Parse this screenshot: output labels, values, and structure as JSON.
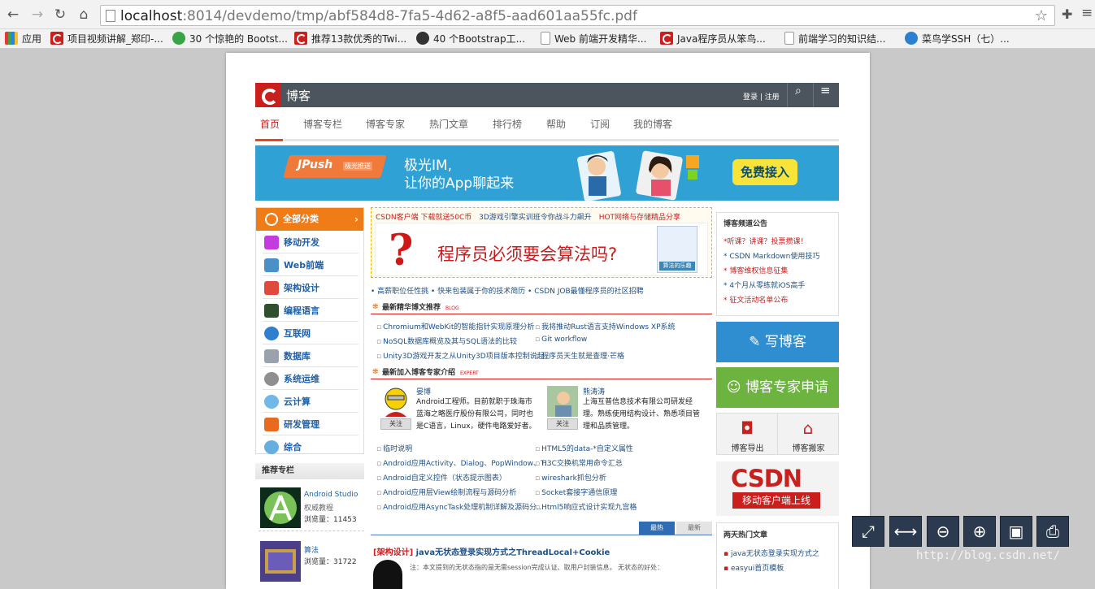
{
  "browser": {
    "back_icon": "arrow-left-icon",
    "url_host": "localhost",
    "url_path": ":8014/devdemo/tmp/abf584d8-7fa5-4d62-a8f5-aad601aa55fc.pdf"
  },
  "bookmarks": [
    {
      "label": "应用"
    },
    {
      "label": "项目视频讲解_郑印-..."
    },
    {
      "label": "30 个惊艳的 Bootst..."
    },
    {
      "label": "推荐13款优秀的Twi..."
    },
    {
      "label": "40 个Bootstrap工..."
    },
    {
      "label": "Web 前端开发精华..."
    },
    {
      "label": "Java程序员从笨鸟..."
    },
    {
      "label": "前端学习的知识结..."
    },
    {
      "label": "菜鸟学SSH（七）..."
    }
  ],
  "site": {
    "title": "博客",
    "login": "登录",
    "register": "注册",
    "tabs": [
      "首页",
      "博客专栏",
      "博客专家",
      "热门文章",
      "排行榜",
      "帮助",
      "订阅",
      "我的博客"
    ]
  },
  "banner": {
    "jpush": "JPush",
    "jpush_sub": "极光推送",
    "line1": "极光IM,",
    "line2": "让你的App聊起来",
    "cta": "免费接入"
  },
  "categories": {
    "header": "全部分类",
    "items": [
      "移动开发",
      "Web前端",
      "架构设计",
      "编程语言",
      "互联网",
      "数据库",
      "系统运维",
      "云计算",
      "研发管理",
      "综合"
    ]
  },
  "recommend": {
    "title": "推荐专栏",
    "items": [
      {
        "name": "Android Studio",
        "sub": "权威教程",
        "views": "浏览量：11453"
      },
      {
        "name": "算法",
        "sub": "",
        "views": "浏览量：31722"
      }
    ]
  },
  "promo": {
    "link1": "CSDN客户端 下载就送50C币",
    "link2": "3D游戏引擎实训班令你战斗力飙升",
    "link3": "HOT网络与存储精品分享",
    "headline": "程序员必须要会算法吗?",
    "book_label": "算法的乐趣"
  },
  "link_strip": "• 高薪职位任性挑 • 快来包装属于你的技术简历 • CSDN JOB最懂程序员的社区招聘",
  "sections": {
    "latest_title": "最新精华博文推荐",
    "latest_tag": "BLOG",
    "latest": [
      "Chromium和WebKit的智能指针实现原理分析",
      "我将推动Rust语言支持Windows XP系统",
      "NoSQL数据库概览及其与SQL语法的比较",
      "Git workflow",
      "Unity3D游戏开发之从Unity3D项目版本控制说起",
      "程序员天生就是查理·芒格"
    ],
    "expert_title": "最新加入博客专家介绍",
    "expert_tag": "EXPERT",
    "experts": [
      {
        "name": "晏博",
        "desc": "Android工程师。目前就职于珠海市蓝海之略医疗股份有限公司，同时也是C语言，Linux，硬件电路爱好者。",
        "follow": "关注"
      },
      {
        "name": "熊涛涛",
        "desc": "上海互普信息技术有限公司研发经理。熟练使用结构设计、熟悉项目管理和品质管理。",
        "follow": "关注"
      }
    ],
    "more": [
      "临时说明",
      "HTML5的data-*自定义属性",
      "Android应用Activity、Dialog、PopWindow、T...",
      "H3C交换机常用命令汇总",
      "Android自定义控件（状态提示图表）",
      "wireshark抓包分析",
      "Android应用层View绘制流程与源码分析",
      "Socket套接字通信原理",
      "Android应用AsyncTask处理机制详解及源码分...",
      "Html5响应式设计实现九宫格"
    ]
  },
  "hot_tabs": {
    "hot": "最热",
    "new": "最新"
  },
  "article": {
    "category": "[架构设计]",
    "title": "java无状态登录实现方式之ThreadLocal+Cookie",
    "snippet": "注：本文提到的无状态指的是无需session完成认证、取用户封装信息。 无状态的好处："
  },
  "notice": {
    "title": "博客频道公告",
    "items": [
      {
        "text": "*听课？讲课？投票攒课！",
        "color": "#c9201e"
      },
      {
        "text": "* CSDN Markdown使用技巧",
        "color": "#1f4f85"
      },
      {
        "text": "* 博客维权信息征集",
        "color": "#c9201e"
      },
      {
        "text": "* 4个月从零练就iOS高手",
        "color": "#1f4f85"
      },
      {
        "text": "* 征文活动名单公布",
        "color": "#c9201e"
      }
    ]
  },
  "right_buttons": {
    "write": "写博客",
    "expert_apply": "博客专家申请",
    "export": "博客导出",
    "move": "博客搬家"
  },
  "csdn_ad": {
    "logo": "CSDN",
    "ribbon": "移动客户端上线"
  },
  "hot2": {
    "title": "两天热门文章",
    "items": [
      "java无状态登录实现方式之",
      "easyui首页模板"
    ]
  },
  "toolbar_icons": [
    "fit-page-icon",
    "fit-width-icon",
    "zoom-out-icon",
    "zoom-in-icon",
    "save-icon",
    "print-icon"
  ],
  "watermark": "http://blog.csdn.net/"
}
